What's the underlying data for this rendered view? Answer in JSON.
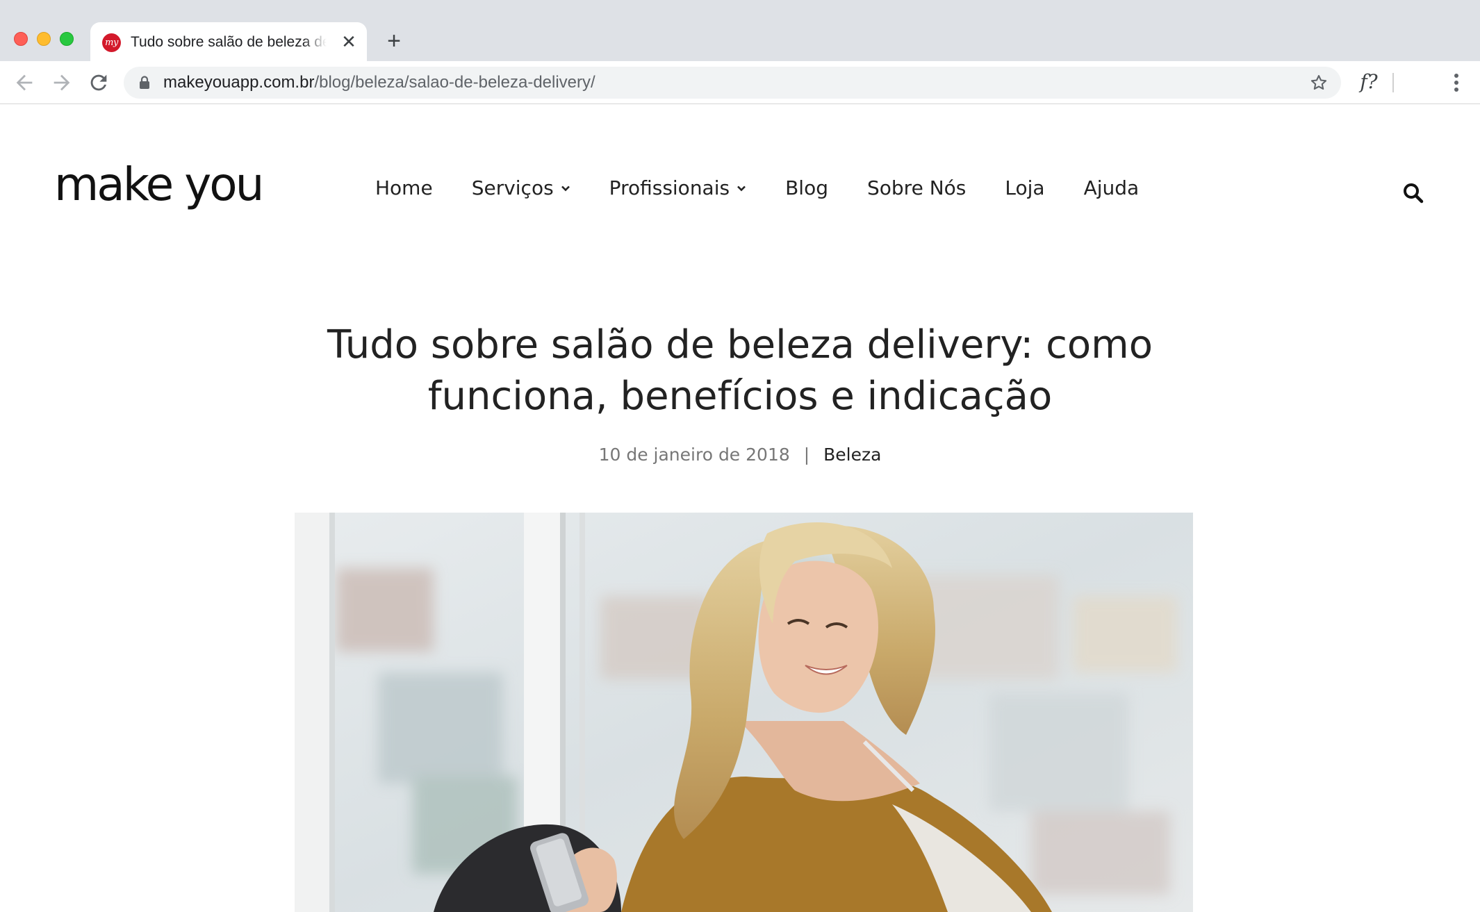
{
  "browser": {
    "tab": {
      "favicon_text": "my",
      "title": "Tudo sobre salão de beleza delivery: como funciona, benefícios e indicação",
      "close": "✕"
    },
    "new_tab": "+",
    "url_host": "makeyouapp.com.br",
    "url_path": "/blog/beleza/salao-de-beleza-delivery/",
    "extension_label": "f?"
  },
  "site": {
    "logo": "make you",
    "nav": [
      "Home",
      "Serviços",
      "Profissionais",
      "Blog",
      "Sobre Nós",
      "Loja",
      "Ajuda"
    ]
  },
  "article": {
    "title": "Tudo sobre salão de beleza delivery: como funciona, benefícios e indicação",
    "date": "10 de janeiro de 2018",
    "separator": "|",
    "category": "Beleza"
  },
  "colors": {
    "favicon_red": "#d3192b",
    "tabstrip": "#dee1e6",
    "sweater": "#a8782a"
  },
  "icons": [
    "back-arrow-icon",
    "forward-arrow-icon",
    "reload-icon",
    "lock-icon",
    "star-icon",
    "kebab-menu-icon",
    "chevron-down-icon",
    "search-icon"
  ]
}
